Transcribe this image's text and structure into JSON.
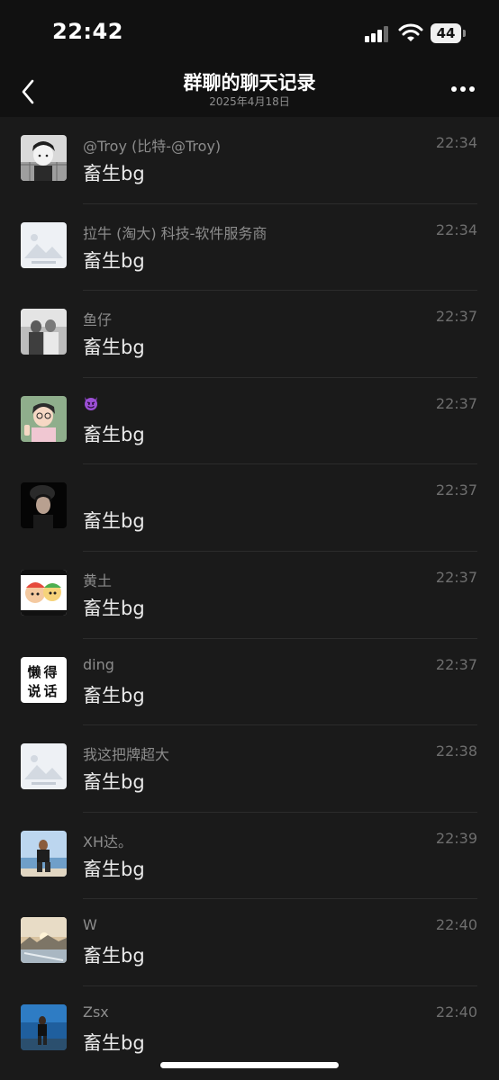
{
  "status_bar": {
    "time": "22:42",
    "battery": "44"
  },
  "nav": {
    "title": "群聊的聊天记录",
    "subtitle": "2025年4月18日"
  },
  "messages": [
    {
      "sender": "@Troy (比特-@Troy)",
      "time": "22:34",
      "content": "畜生bg",
      "avatar": "anime-boy-avatar"
    },
    {
      "sender": "拉牛 (淘大) 科技-软件服务商",
      "time": "22:34",
      "content": "畜生bg",
      "avatar": "image-placeholder-avatar"
    },
    {
      "sender": "鱼仔",
      "time": "22:37",
      "content": "畜生bg",
      "avatar": "two-people-photo-avatar"
    },
    {
      "sender": "",
      "time": "22:37",
      "content": "畜生bg",
      "avatar": "anime-character-avatar",
      "sender_icon": "devil-emoji-icon"
    },
    {
      "sender": "",
      "time": "22:37",
      "content": "畜生bg",
      "avatar": "dark-portrait-avatar"
    },
    {
      "sender": "黄土",
      "time": "22:37",
      "content": "畜生bg",
      "avatar": "cartoon-avatar"
    },
    {
      "sender": "ding",
      "time": "22:37",
      "content": "畜生bg",
      "avatar": "text-avatar",
      "avatar_text": [
        "懒得",
        "说话"
      ]
    },
    {
      "sender": "我这把牌超大",
      "time": "22:38",
      "content": "畜生bg",
      "avatar": "image-placeholder-avatar"
    },
    {
      "sender": "XH达。",
      "time": "22:39",
      "content": "畜生bg",
      "avatar": "beach-person-avatar"
    },
    {
      "sender": "W",
      "time": "22:40",
      "content": "畜生bg",
      "avatar": "landscape-avatar"
    },
    {
      "sender": "Zsx",
      "time": "22:40",
      "content": "畜生bg",
      "avatar": "blue-photo-avatar"
    }
  ],
  "colors": {
    "background": "#1a1a1a",
    "bar": "#111111",
    "divider": "#2c2c2c",
    "secondary_text": "#8c8c8c"
  }
}
